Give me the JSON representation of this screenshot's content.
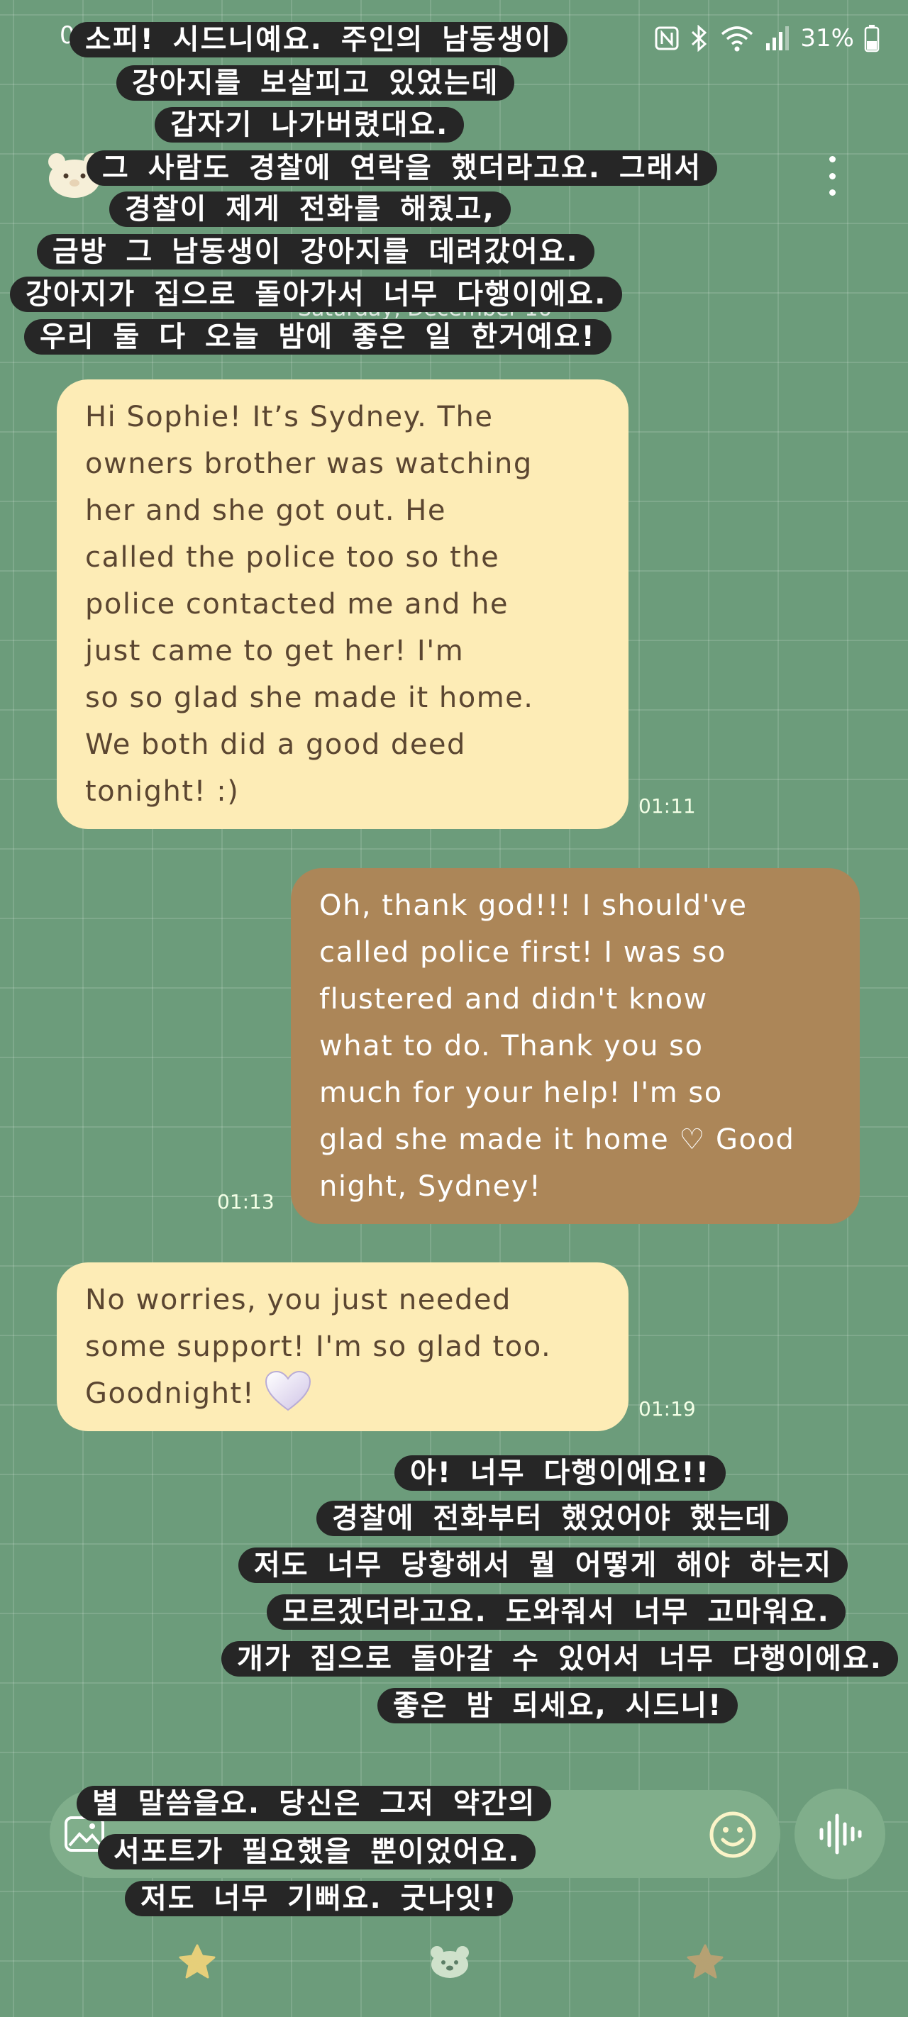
{
  "status_bar": {
    "time": "01:19",
    "battery": "31%",
    "icons": [
      "nfc-icon",
      "bluetooth-icon",
      "wifi-icon",
      "signal-icon",
      "battery-icon"
    ]
  },
  "header": {
    "avatar_icon": "bear-avatar-icon",
    "menu_icon": "more-vertical-icon"
  },
  "conversation": {
    "date_separator": "Saturday, December 16",
    "messages": [
      {
        "direction": "incoming",
        "text": "Hi Sophie! It’s Sydney. The\nowners brother was watching\nher and she got out. He\ncalled the police too so the\npolice contacted me and he\njust came to get her! I'm\nso so glad she made it home.\nWe both did a good deed\ntonight! :)",
        "time": "01:11"
      },
      {
        "direction": "outgoing",
        "text": "Oh, thank god!!! I should've\ncalled police first! I was so\nflustered and didn't know\nwhat to do. Thank you so\nmuch for your help! I'm so\nglad she made it home ♡ Good\nnight, Sydney!",
        "time": "01:13"
      },
      {
        "direction": "incoming",
        "text": "No worries, you just needed\nsome support! I'm so glad too.\nGoodnight!",
        "emoji": "white-heart-icon",
        "time": "01:19"
      }
    ]
  },
  "translations": {
    "block1": [
      "소피! 시드니예요. 주인의 남동생이",
      "강아지를 보살피고 있었는데",
      "갑자기 나가버렸대요.",
      "그 사람도 경찰에 연락을 했더라고요. 그래서",
      "경찰이 제게 전화를 해줬고,",
      "금방 그 남동생이 강아지를 데려갔어요.",
      "강아지가 집으로 돌아가서 너무 다행이에요.",
      "우리 둘 다 오늘 밤에 좋은 일 한거예요!"
    ],
    "block2": [
      "아! 너무 다행이에요!!",
      "경찰에 전화부터 했었어야 했는데",
      "저도 너무 당황해서 뭘 어떻게 해야 하는지",
      "모르겠더라고요. 도와줘서 너무 고마워요.",
      "개가 집으로 돌아갈 수 있어서 너무 다행이에요.",
      "좋은 밤 되세요, 시드니!"
    ],
    "block3": [
      "별 말씀을요. 당신은 그저 약간의",
      "서포트가 필요했을 뿐이었어요.",
      "저도 너무 기뻐요. 굿나잇!"
    ]
  },
  "input_bar": {
    "placeholder": "",
    "icons": [
      "gallery-icon",
      "emoji-icon",
      "voice-wave-icon"
    ]
  },
  "bottom_nav": {
    "items": [
      "star-icon",
      "bear-icon",
      "star-icon"
    ]
  },
  "colors": {
    "background": "#6c9c7b",
    "incoming_bubble": "#fdecb6",
    "outgoing_bubble": "#ac8658",
    "overlay": "#262626"
  }
}
